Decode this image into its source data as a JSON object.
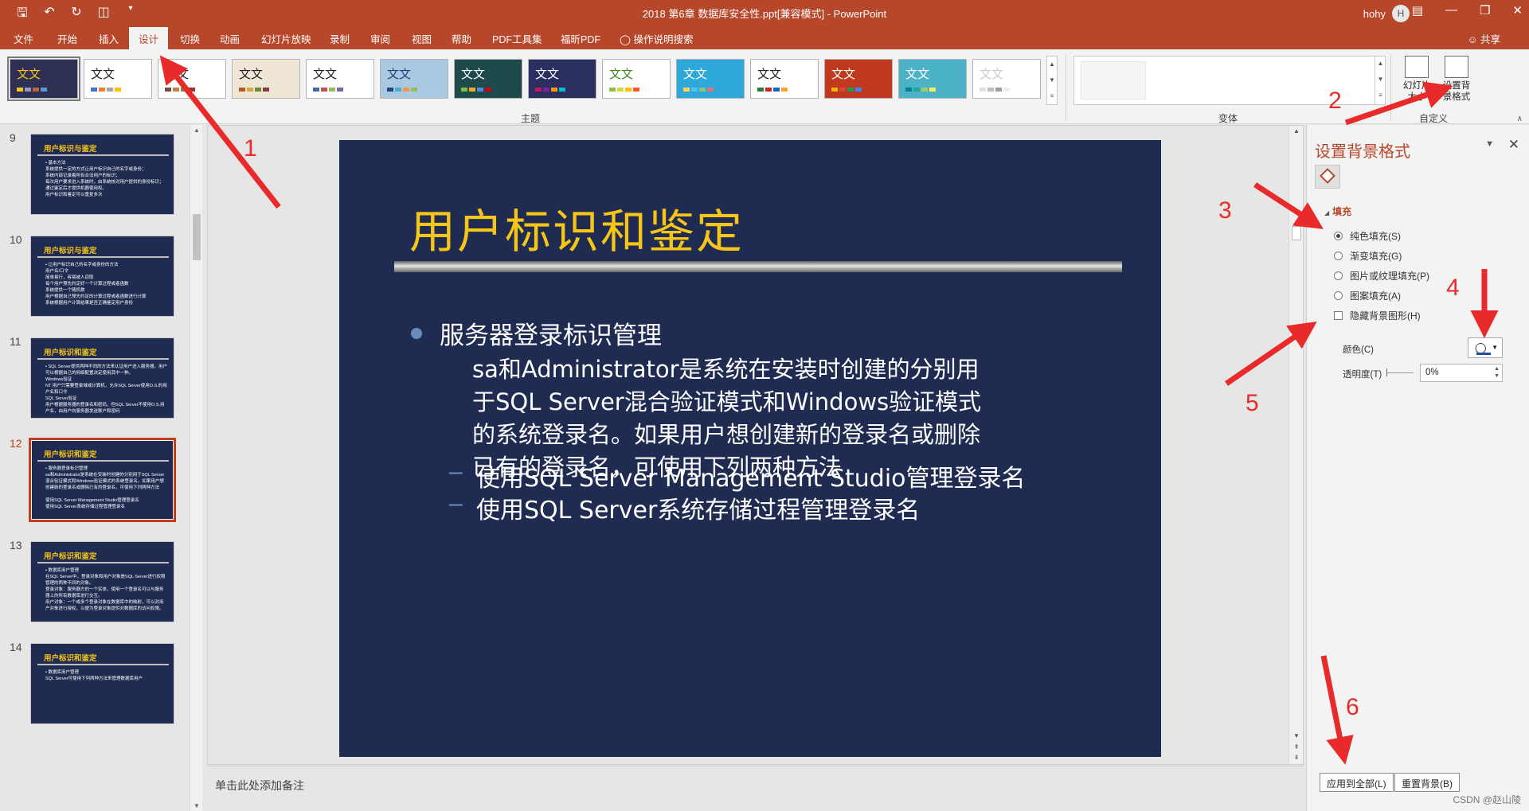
{
  "titlebar": {
    "doc_title": "2018 第6章 数据库安全性.ppt[兼容模式]  -  PowerPoint",
    "user_name": "hohy",
    "user_initial": "H",
    "qat_icons": [
      "save-icon",
      "undo-icon",
      "redo-icon",
      "start-slideshow-icon",
      "customize-qat-icon"
    ],
    "win_icons": [
      "ribbon-display-icon",
      "minimize-icon",
      "restore-icon",
      "close-icon"
    ]
  },
  "menu": {
    "tabs": [
      "文件",
      "开始",
      "插入",
      "设计",
      "切换",
      "动画",
      "幻灯片放映",
      "录制",
      "审阅",
      "视图",
      "帮助",
      "PDF工具集",
      "福昕PDF"
    ],
    "active": "设计",
    "search": "操作说明搜索",
    "share": "共享"
  },
  "ribbon": {
    "themes_group": "主题",
    "theme_label": "文文",
    "theme_colors": [
      "#2d2f55",
      "#ffffff",
      "#ffffff",
      "#f0e6d6",
      "#ffffff",
      "#a9c9e3",
      "#1e4a4b",
      "#2b2f5f",
      "#ffffff",
      "#2ea8d8",
      "#ffffff",
      "#c0391e",
      "#4bb3c5",
      "#ffffff"
    ],
    "variants_group": "变体",
    "slide_size": "幻灯片\n大小",
    "format_bg": "设置背\n景格式",
    "customize_group": "自定义"
  },
  "thumbnails": [
    {
      "num": "9",
      "title": "用户标识与鉴定",
      "body": "• 基本方法\n  系统提供一定的方式让用户标识自己的名字或身份；\n  系统内部记录着所有合法用户的标识；\n  每次用户要求进入系统时，由系统核对用户提供的身份标识；\n  通过鉴定后才提供机器使用权。\n  用户标识和鉴定可以重复多次"
    },
    {
      "num": "10",
      "title": "用户标识与鉴定",
      "body": "• 让用户标识自己的名字或身份的方法\n  用户名/口令\n    简单易行，容易被人窃取\n  每个用户预先约定好一个计算过程或者函数\n    系统提供一个随机数\n    用户根据自己预先约定的计算过程或者函数进行计算\n    系统根据用户计算结果是否正确鉴定用户身份"
    },
    {
      "num": "11",
      "title": "用户标识和鉴定",
      "body": "• SQL Server提供两种不同的方法来认证用户进入服务器，用户可以根据自己的网络配置决定使用其中一种。\n  Windows验证\n    NT 用户只需要登录域或计算机，允许SQL Server使用O.S.的用户名和口令\n  SQL Server验证\n    用户根据服务器的登录名和密码，但SQL Server不使用O.S.用户名，由用户向服务器发送账户和密码"
    },
    {
      "num": "12",
      "title": "用户标识和鉴定",
      "body": "• 服务器登录标识管理\n  sa和Administrator是系统在安装时创建的分别用于SQL Server混合验证模式和Windows验证模式的系统登录名。如果用户想创建新的登录名或删除已有的登录名，可使用下列两种方法\n\n  使用SQL Server Management Studio管理登录名\n  使用SQL Server系统存储过程管理登录名"
    },
    {
      "num": "13",
      "title": "用户标识和鉴定",
      "body": "• 数据库用户管理\n  在SQL Server中，登录对象和用户对象是SQL Server进行权限管理的两种不同的对象。\n  登录对象：服务器方的一个实体，使用一个登录名可以与服务器上的所有数据库进行交互。\n  用户对象：一个或多个登录对象在数据库中的映射，可以对用户对象进行授权，以便为登录对象提供对数据库的访问权限。"
    },
    {
      "num": "14",
      "title": "用户标识和鉴定",
      "body": "• 数据库用户管理\n  SQL Server可使用下列两种方法来管理数据库用户"
    }
  ],
  "active_slide": "12",
  "slide": {
    "title": "用户标识和鉴定",
    "bullet1": "服务器登录标识管理",
    "paragraph": [
      "sa和Administrator是系统在安装时创建的分别用",
      "于SQL Server混合验证模式和Windows验证模式",
      "的系统登录名。如果用户想创建新的登录名或删除",
      "已有的登录名，可使用下列两种方法"
    ],
    "sub1": "使用SQL Server Management Studio管理登录名",
    "sub2": "使用SQL Server系统存储过程管理登录名",
    "dash": "–"
  },
  "notes_placeholder": "单击此处添加备注",
  "format_pane": {
    "title": "设置背景格式",
    "section": "填充",
    "options": [
      "纯色填充(S)",
      "渐变填充(G)",
      "图片或纹理填充(P)",
      "图案填充(A)"
    ],
    "selected_option": "纯色填充(S)",
    "hide_bg": "隐藏背景图形(H)",
    "color_label": "颜色(C)",
    "transparency_label": "透明度(T)",
    "transparency_value": "0%",
    "apply_all": "应用到全部(L)",
    "reset_bg": "重置背景(B)"
  },
  "annotations": [
    "1",
    "2",
    "3",
    "4",
    "5",
    "6"
  ],
  "watermark": "CSDN @赵山陵",
  "colors": {
    "accent": "#b7472a",
    "slide_bg": "#1f2b50",
    "slide_title": "#f5c518",
    "annotation": "#e82a2a"
  }
}
